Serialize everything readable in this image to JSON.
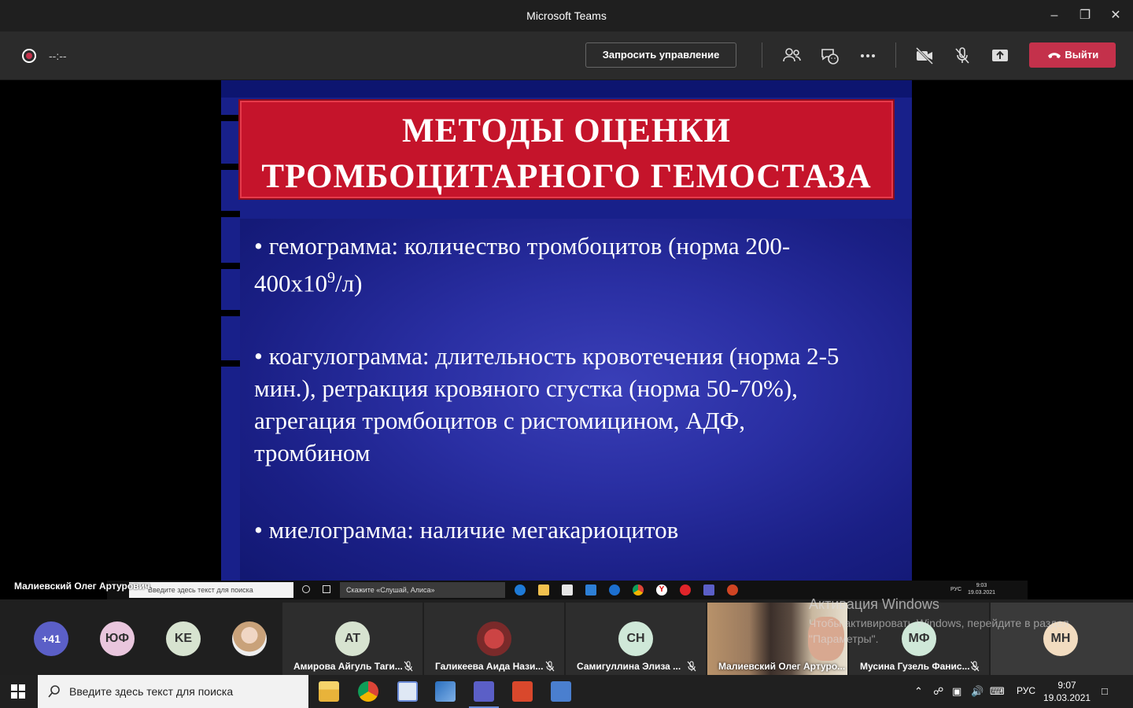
{
  "window": {
    "title": "Microsoft Teams"
  },
  "toolbar": {
    "timer": "--:--",
    "request_control": "Запросить управление",
    "leave": "Выйти"
  },
  "slide": {
    "title_line1": "МЕТОДЫ ОЦЕНКИ",
    "title_line2": "ТРОМБОЦИТАРНОГО ГЕМОСТАЗА",
    "bullet1_a": "• гемограмма: количество тромбоцитов (норма 200-",
    "bullet1_b": "400х10",
    "bullet1_sup": "9",
    "bullet1_c": "/л)",
    "bullet2_l1": "• коагулограмма: длительность кровотечения (норма 2-5",
    "bullet2_l2": "мин.), ретракция кровяного сгустка (норма 50-70%),",
    "bullet2_l3": "агрегация тромбоцитов с ристомицином, АДФ,",
    "bullet2_l4": "тромбином",
    "bullet3": "• миелограмма: наличие мегакариоцитов"
  },
  "shared_screen": {
    "presenter": "Малиевский Олег Артурович",
    "search_placeholder": "Введите здесь текст для поиска",
    "alice": "Скажите «Слушай, Алиса»",
    "lang": "РУС",
    "time": "9:03",
    "date": "19.03.2021"
  },
  "roster": {
    "overflow": "+41",
    "avatars": [
      {
        "initials": "ЮФ",
        "color": "#e9c6dd"
      },
      {
        "initials": "KE",
        "color": "#d7e3d0"
      }
    ],
    "tiles": [
      {
        "initials": "AT",
        "color": "#d7e3d0",
        "name": "Амирова Айгуль Таги..."
      },
      {
        "initials": "",
        "color": "#d46a6a",
        "name": "Галикеева Аида Нази..."
      },
      {
        "initials": "CH",
        "color": "#cfe8d8",
        "name": "Самигуллина Элиза ..."
      },
      {
        "initials": "",
        "color": "#7a6a5a",
        "name": "Малиевский Олег Артуро..."
      },
      {
        "initials": "МФ",
        "color": "#cfe8d8",
        "name": "Мусина Гузель Фанис..."
      },
      {
        "initials": "МН",
        "color": "#f2dcc0",
        "name": ""
      }
    ]
  },
  "watermark": {
    "title": "Активация Windows",
    "text": "Чтобы активировать Windows, перейдите в раздел \"Параметры\"."
  },
  "taskbar": {
    "search_placeholder": "Введите здесь текст для поиска",
    "lang": "РУС",
    "time": "9:07",
    "date": "19.03.2021"
  }
}
